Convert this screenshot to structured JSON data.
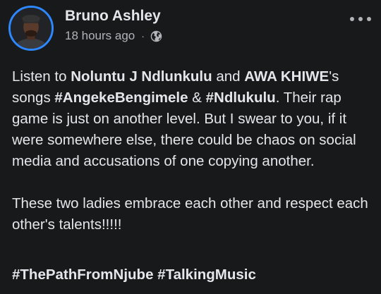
{
  "post": {
    "author": "Bruno Ashley",
    "timestamp": "18 hours ago",
    "separator": "·",
    "audience_icon": "globe-icon",
    "more_icon": "more-horizontal-icon",
    "body": {
      "p1": {
        "t1": "Listen to ",
        "name1": "Noluntu J Ndlunkulu",
        "t2": " and ",
        "name2": "AWA KHIWE",
        "t3": "'s songs ",
        "tag1": "#AngekeBengimele",
        "t4": " & ",
        "tag2": "#Ndlukulu",
        "t5": ". Their rap game is just on another level. But I swear to you, if it were somewhere else, there could be chaos on social media and accusations of one copying another."
      },
      "p2": "These two ladies embrace each other and respect each other's talents!!!!!"
    },
    "hashtags": [
      "#ThePathFromNjube",
      "#TalkingMusic"
    ]
  },
  "colors": {
    "background": "#18191a",
    "text_primary": "#e4e6eb",
    "text_secondary": "#b0b3b8",
    "avatar_ring": "#2d88ff"
  }
}
